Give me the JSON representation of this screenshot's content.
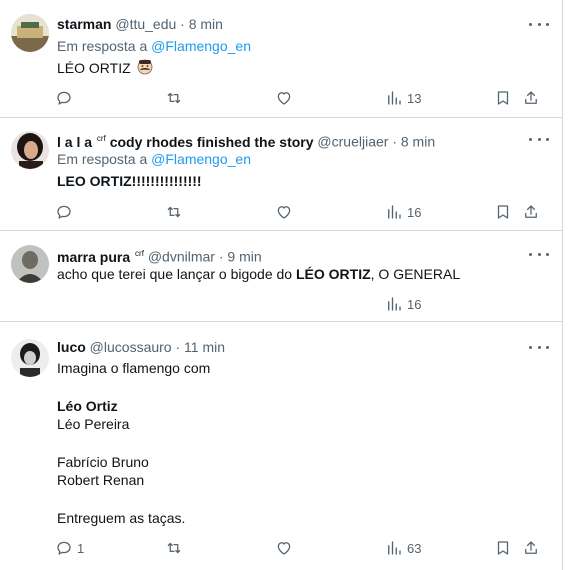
{
  "replying_prefix": "Em resposta a ",
  "colors": {
    "text": "#0f1419",
    "muted": "#536471",
    "link": "#1d9bf0",
    "border": "#cfd9de"
  },
  "icons": {
    "reply": "reply-icon",
    "retweet": "retweet-icon",
    "like": "heart-icon",
    "views": "views-icon",
    "bookmark": "bookmark-icon",
    "share": "share-icon",
    "more": "more-icon"
  },
  "tweets": [
    {
      "name": "starman",
      "handle": "@ttu_edu",
      "time": "· 8 min",
      "replying_to": "@Flamengo_en",
      "text": "LÉO ORTIZ",
      "emoji": "mustache-face-emoji",
      "replies": "",
      "views": "13"
    },
    {
      "name_a": "l a l a",
      "badge": "crf",
      "name_b": "cody rhodes finished the story",
      "handle": "@crueljiaer",
      "time": "· 8 min",
      "replying_to": "@Flamengo_en",
      "text": "LEO ORTIZ!!!!!!!!!!!!!!!",
      "replies": "",
      "views": "16"
    },
    {
      "name": "marra pura",
      "badge": "crf",
      "handle": "@dvnilmar",
      "time": "· 9 min",
      "text_a": "acho que terei que lançar o bigode do ",
      "text_b": "LÉO ORTIZ",
      "text_c": ", O GENERAL",
      "replies": "",
      "views": "16"
    },
    {
      "name": "luco",
      "handle": "@lucossauro",
      "time": "· 11 min",
      "lines": [
        "Imagina o flamengo com",
        "Léo Ortiz",
        "Léo Pereira",
        "Fabrício Bruno",
        "Robert Renan",
        "Entreguem as taças."
      ],
      "replies": "1",
      "views": "63"
    }
  ]
}
